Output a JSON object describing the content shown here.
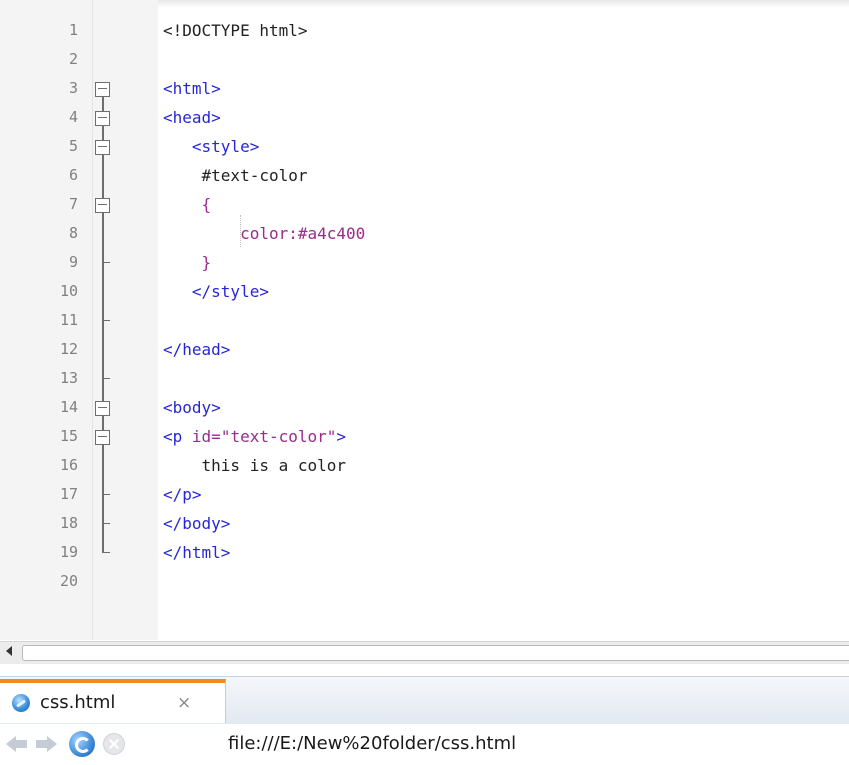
{
  "editor": {
    "lines": [
      {
        "num": "1",
        "tokens": [
          {
            "text": "<!DOCTYPE html>",
            "color": "black"
          }
        ]
      },
      {
        "num": "2",
        "tokens": []
      },
      {
        "num": "3",
        "tokens": [
          {
            "text": "<html>",
            "color": "blue"
          }
        ]
      },
      {
        "num": "4",
        "tokens": [
          {
            "text": "<head>",
            "color": "blue"
          }
        ]
      },
      {
        "num": "5",
        "tokens": [
          {
            "text": "   <style>",
            "color": "blue"
          }
        ]
      },
      {
        "num": "6",
        "tokens": [
          {
            "text": "    #text-color",
            "color": "black"
          }
        ]
      },
      {
        "num": "7",
        "tokens": [
          {
            "text": "    {",
            "color": "purple"
          }
        ]
      },
      {
        "num": "8",
        "tokens": [
          {
            "text": "        color:",
            "color": "purple"
          },
          {
            "text": "#a4c400",
            "color": "purple"
          }
        ]
      },
      {
        "num": "9",
        "tokens": [
          {
            "text": "    }",
            "color": "purple"
          }
        ]
      },
      {
        "num": "10",
        "tokens": [
          {
            "text": "   </style>",
            "color": "blue"
          }
        ]
      },
      {
        "num": "11",
        "tokens": []
      },
      {
        "num": "12",
        "tokens": [
          {
            "text": "</head>",
            "color": "blue"
          }
        ]
      },
      {
        "num": "13",
        "tokens": []
      },
      {
        "num": "14",
        "tokens": [
          {
            "text": "<body>",
            "color": "blue"
          }
        ]
      },
      {
        "num": "15",
        "tokens": [
          {
            "text": "<p ",
            "color": "blue"
          },
          {
            "text": "id=",
            "color": "purple"
          },
          {
            "text": "\"text-color\"",
            "color": "purple"
          },
          {
            "text": ">",
            "color": "blue"
          }
        ]
      },
      {
        "num": "16",
        "tokens": [
          {
            "text": "    this is a color",
            "color": "black"
          }
        ]
      },
      {
        "num": "17",
        "tokens": [
          {
            "text": "</p>",
            "color": "blue"
          }
        ]
      },
      {
        "num": "18",
        "tokens": [
          {
            "text": "</body>",
            "color": "blue"
          }
        ]
      },
      {
        "num": "19",
        "tokens": [
          {
            "text": "</html>",
            "color": "blue"
          }
        ]
      },
      {
        "num": "20",
        "tokens": []
      }
    ],
    "fold_markers": [
      3,
      4,
      5,
      7,
      14,
      15
    ],
    "fold_ticks": [
      9,
      11,
      13,
      17,
      18
    ],
    "fold_end": 19
  },
  "tab": {
    "label": "css.html",
    "close_glyph": "×",
    "icon": "browser-globe-icon"
  },
  "nav": {
    "back_icon": "back-arrow-icon",
    "forward_icon": "forward-arrow-icon",
    "reload_icon": "reload-icon",
    "stop_icon": "stop-icon",
    "url": "file:///E:/New%20folder/css.html"
  },
  "colors": {
    "black": "#222222",
    "blue": "#2626d9",
    "purple": "#9a2a8c",
    "tab_accent": "#f08a24"
  }
}
